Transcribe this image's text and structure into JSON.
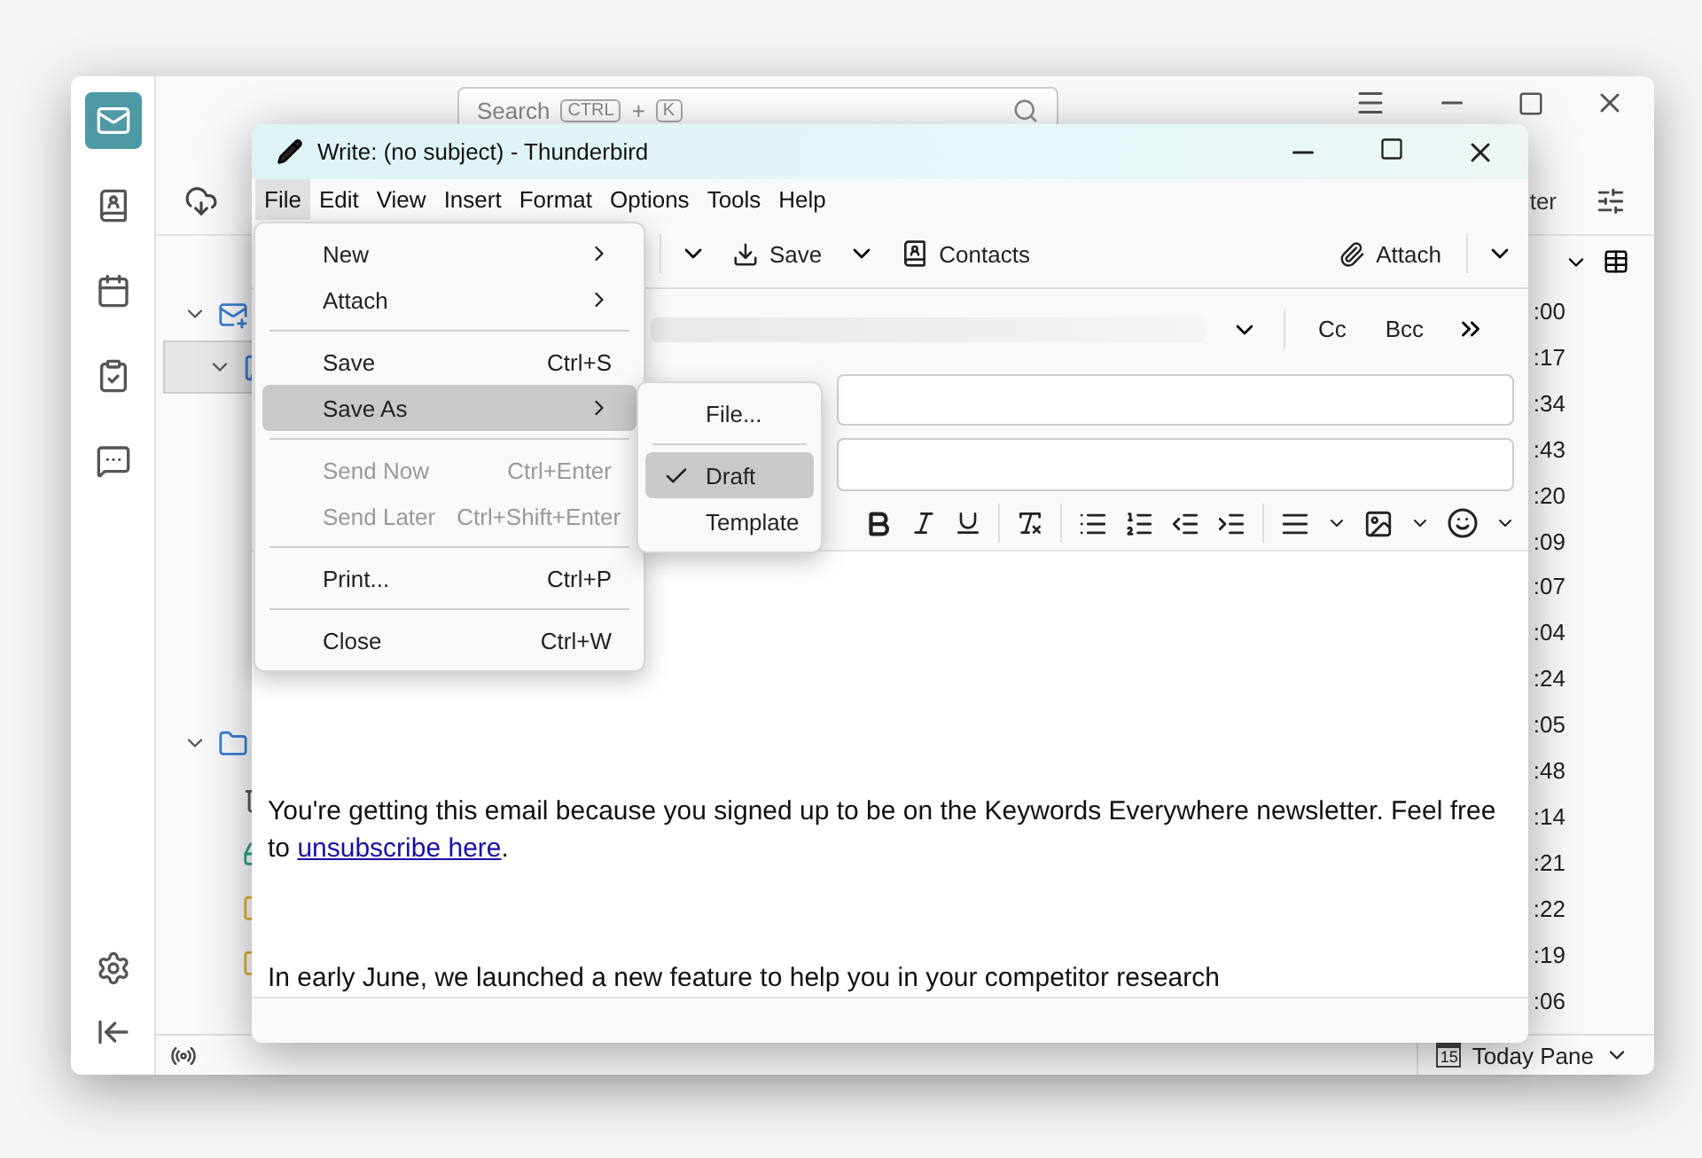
{
  "background_window": {
    "spaces": [
      {
        "kind": "mail",
        "selected": true
      },
      {
        "kind": "contacts",
        "selected": false
      },
      {
        "kind": "calendar",
        "selected": false
      },
      {
        "kind": "tasks",
        "selected": false
      },
      {
        "kind": "chat",
        "selected": false
      }
    ],
    "search": {
      "placeholder": "Search",
      "keys": [
        "CTRL",
        "+",
        "K"
      ]
    },
    "filter_label": "ter",
    "folders": [
      {
        "kind": "account",
        "expanded": true,
        "selected": false
      },
      {
        "kind": "account-sub",
        "expanded": true,
        "selected": true
      },
      {
        "kind": "local",
        "expanded": true,
        "selected": false
      },
      {
        "kind": "trash",
        "selected": false
      },
      {
        "kind": "teal",
        "selected": false
      },
      {
        "kind": "folder",
        "selected": false
      },
      {
        "kind": "folder",
        "selected": false
      }
    ],
    "times": [
      ":00",
      ":17",
      ":34",
      ":43",
      ":20",
      ":09",
      ":07",
      ":04",
      ":24",
      ":05",
      ":48",
      ":14",
      ":21",
      ":22",
      ":19",
      ":06"
    ],
    "status_bar": {
      "calendar_day": "15",
      "today_pane": "Today Pane"
    }
  },
  "compose": {
    "title": "Write: (no subject) - Thunderbird",
    "menu_bar": [
      {
        "label": "File",
        "selected": true
      },
      {
        "label": "Edit",
        "selected": false
      },
      {
        "label": "View",
        "selected": false
      },
      {
        "label": "Insert",
        "selected": false
      },
      {
        "label": "Format",
        "selected": false
      },
      {
        "label": "Options",
        "selected": false
      },
      {
        "label": "Tools",
        "selected": false
      },
      {
        "label": "Help",
        "selected": false
      }
    ],
    "toolbar": {
      "save": "Save",
      "contacts": "Contacts",
      "attach": "Attach"
    },
    "header_buttons": [
      "Cc",
      "Bcc"
    ],
    "body": {
      "text_before": "You're getting this email because you signed up to be on the Keywords Everywhere newsletter. Feel free to ",
      "link": "unsubscribe here",
      "text_after": ".",
      "last_line": "In early June, we launched a new feature to help you in your competitor research"
    }
  },
  "file_menu": [
    {
      "kind": "item",
      "label": "New",
      "submenu": true,
      "disabled": false,
      "selected": false
    },
    {
      "kind": "item",
      "label": "Attach",
      "submenu": true,
      "disabled": false,
      "selected": false
    },
    {
      "kind": "separator"
    },
    {
      "kind": "item",
      "label": "Save",
      "shortcut": "Ctrl+S",
      "disabled": false,
      "selected": false
    },
    {
      "kind": "item",
      "label": "Save As",
      "submenu": true,
      "disabled": false,
      "selected": true
    },
    {
      "kind": "separator"
    },
    {
      "kind": "item",
      "label": "Send Now",
      "shortcut": "Ctrl+Enter",
      "disabled": true,
      "selected": false
    },
    {
      "kind": "item",
      "label": "Send Later",
      "shortcut": "Ctrl+Shift+Enter",
      "disabled": true,
      "selected": false
    },
    {
      "kind": "separator"
    },
    {
      "kind": "item",
      "label": "Print...",
      "shortcut": "Ctrl+P",
      "disabled": false,
      "selected": false
    },
    {
      "kind": "separator"
    },
    {
      "kind": "item",
      "label": "Close",
      "shortcut": "Ctrl+W",
      "disabled": false,
      "selected": false
    }
  ],
  "save_as_submenu": [
    {
      "kind": "item",
      "label": "File...",
      "checked": false,
      "selected": false
    },
    {
      "kind": "separator"
    },
    {
      "kind": "item",
      "label": "Draft",
      "checked": true,
      "selected": true
    },
    {
      "kind": "item",
      "label": "Template",
      "checked": false,
      "selected": false
    }
  ]
}
